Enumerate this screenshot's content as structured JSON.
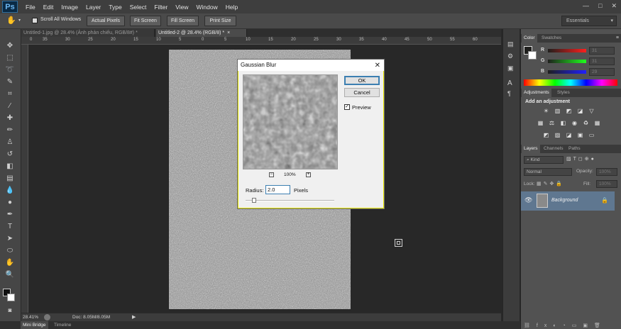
{
  "app": {
    "logo": "Ps"
  },
  "menu": [
    "File",
    "Edit",
    "Image",
    "Layer",
    "Type",
    "Select",
    "Filter",
    "View",
    "Window",
    "Help"
  ],
  "window_controls": {
    "minimize": "—",
    "restore": "□",
    "close": "✕"
  },
  "options_bar": {
    "scroll_all_windows": "Scroll All Windows",
    "actual_pixels": "Actual Pixels",
    "fit_screen": "Fit Screen",
    "fill_screen": "Fill Screen",
    "print_size": "Print Size",
    "workspace": "Essentials"
  },
  "tabs": [
    {
      "label": "Untitled-1.jpg @ 28.4% (Ảnh phản chiếu, RGB/8#) *"
    },
    {
      "label": "Untitled-2 @ 28.4% (RGB/8) *"
    }
  ],
  "ruler_ticks": [
    "0",
    "35",
    "30",
    "25",
    "20",
    "15",
    "10",
    "5",
    "0",
    "5",
    "10",
    "15",
    "20",
    "25",
    "30",
    "35",
    "40",
    "45",
    "50",
    "55",
    "60"
  ],
  "status": {
    "zoom": "28.41%",
    "doc": "Doc: 8.05M/8.05M"
  },
  "bottom_tabs": [
    "Mini Bridge",
    "Timeline"
  ],
  "dialog": {
    "title": "Gaussian Blur",
    "ok": "OK",
    "cancel": "Cancel",
    "preview_label": "Preview",
    "preview_checked": true,
    "zoom": "100%",
    "radius_label": "Radius:",
    "radius_value": "2.0",
    "unit": "Pixels"
  },
  "color_panel": {
    "tabs": [
      "Color",
      "Swatches"
    ],
    "channels": [
      {
        "label": "R",
        "value": "31"
      },
      {
        "label": "G",
        "value": "31"
      },
      {
        "label": "B",
        "value": "29"
      }
    ]
  },
  "adjustments_panel": {
    "tabs": [
      "Adjustments",
      "Styles"
    ],
    "heading": "Add an adjustment"
  },
  "layers_panel": {
    "tabs": [
      "Layers",
      "Channels",
      "Paths"
    ],
    "filter": "Kind",
    "blend_mode": "Normal",
    "opacity_label": "Opacity:",
    "opacity": "100%",
    "lock_label": "Lock:",
    "fill_label": "Fill:",
    "fill": "100%",
    "layer_name": "Background"
  },
  "colors": {
    "accent_blue": "#3c7fb1",
    "panel": "#525252",
    "workspace": "#282828"
  }
}
